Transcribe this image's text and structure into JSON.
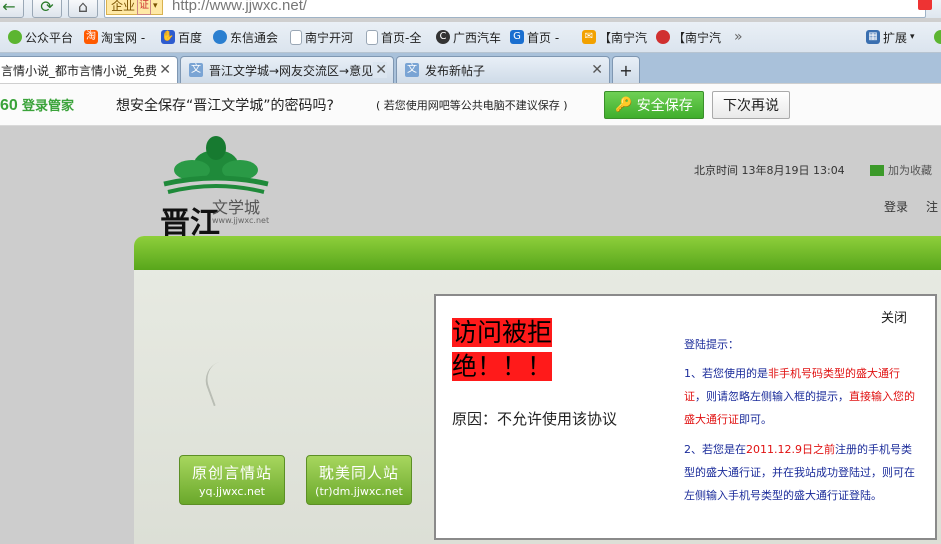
{
  "toolbar": {
    "back_icon": "back-arrow-icon",
    "refresh_icon": "refresh-icon",
    "home_icon": "home-icon",
    "badge_label": "企业",
    "badge_sub": "证",
    "url": "http://www.jjwxc.net/"
  },
  "bookmarks": [
    {
      "label": "公众平台",
      "icon": "wechat-icon",
      "color": "#5cb531"
    },
    {
      "label": "淘宝网 -",
      "icon": "taobao-icon",
      "color": "#ff5a00"
    },
    {
      "label": "百度",
      "icon": "baidu-icon",
      "color": "#2e5ccf"
    },
    {
      "label": "东信通会",
      "icon": "globe-icon",
      "color": "#2b7fd0"
    },
    {
      "label": "南宁开河",
      "icon": "page-icon",
      "color": "#9aa7b5"
    },
    {
      "label": "首页-全",
      "icon": "page-icon",
      "color": "#9aa7b5"
    },
    {
      "label": "广西汽车",
      "icon": "circle-c-icon",
      "color": "#333333"
    },
    {
      "label": "首页 -",
      "icon": "g-logo-icon",
      "color": "#1a6fd0"
    },
    {
      "label": "【南宁汽",
      "icon": "mail-icon",
      "color": "#f2a100"
    },
    {
      "label": "【南宁汽",
      "icon": "globe-red-icon",
      "color": "#d03030"
    }
  ],
  "bookmarks_more": "»",
  "extensions_label": "扩展",
  "tabs": [
    {
      "label": "言情小说_都市言情小说_免费言",
      "active": true
    },
    {
      "label": "晋江文学城→网友交流区→意见",
      "active": false
    },
    {
      "label": "发布新帖子",
      "active": false
    }
  ],
  "new_tab": "+",
  "password_bar": {
    "logo": "60",
    "logo_text": "登录管家",
    "question": "想安全保存“晋江文学城”的密码吗?",
    "note": "( 若您使用网吧等公共电脑不建议保存 )",
    "save_label": "安全保存",
    "later_label": "下次再说"
  },
  "site": {
    "logo_name": "文学城",
    "logo_url": "www.jjwxc.net",
    "logo_calligraphy": "晋江",
    "time_label": "北京时间  13年8月19日 13:04",
    "favorite_label": "加为收藏",
    "login_label": "登录",
    "register_label": "注",
    "btn1_title": "原创言情站",
    "btn1_url": "yq.jjwxc.net",
    "btn2_title": "耽美同人站",
    "btn2_url": "(tr)dm.jjwxc.net"
  },
  "dialog": {
    "close_label": "关闭",
    "denied_line1": "访问被拒",
    "denied_line2": "绝！！！",
    "reason": "原因：不允许使用该协议",
    "tip_head": "登陆提示：",
    "tip1_a": "1、若您使用的是",
    "tip1_b": "非手机号码类型的盛大通行证",
    "tip1_c": "，则请忽略左侧输入框的提示，",
    "tip1_d": "直接输入您的盛大通行证",
    "tip1_e": "即可。",
    "tip2_a": "2、若您是在",
    "tip2_b": "2011.12.9日之前",
    "tip2_c": "注册的手机号类型的盛大通行证，并在我站成功登陆过，则可在左侧输入手机号类型的盛大通行证登陆。"
  }
}
